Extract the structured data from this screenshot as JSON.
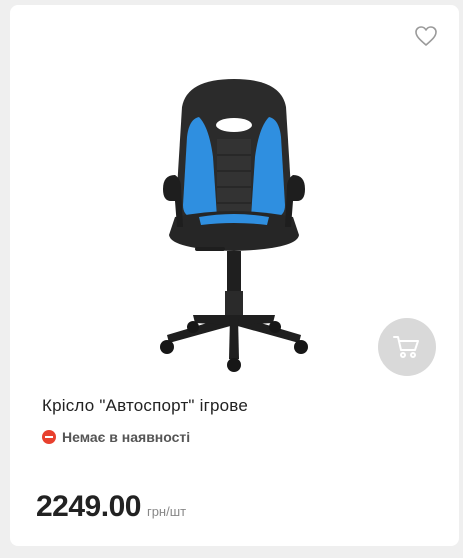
{
  "product": {
    "title": "Крісло \"Автоспорт\" ігрове",
    "availability": "Немає в наявності",
    "price": "2249.00",
    "unit": "грн/шт",
    "image_icon": "gaming-chair-image"
  },
  "icons": {
    "wishlist": "heart-icon",
    "cart": "cart-icon"
  },
  "colors": {
    "unavailable": "#e8402e",
    "chair_accent": "#2f8fe0",
    "cart_button": "#d9d9d9"
  }
}
